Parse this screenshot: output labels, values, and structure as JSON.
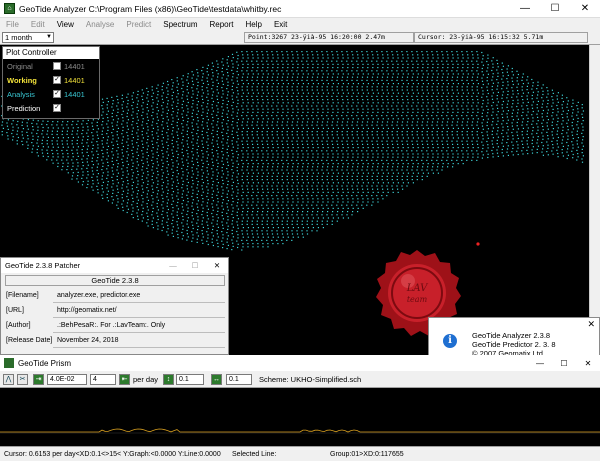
{
  "window": {
    "title": "GeoTide Analyzer  C:\\Program Files (x86)\\GeoTide\\testdata\\whitby.rec",
    "min": "—",
    "max": "☐",
    "close": "✕"
  },
  "menu": [
    "File",
    "Edit",
    "View",
    "Analyse",
    "Predict",
    "Spectrum",
    "Report",
    "Help",
    "Exit"
  ],
  "menu_disabled": [
    true,
    true,
    false,
    true,
    true,
    false,
    false,
    false,
    false
  ],
  "toolbar": {
    "range": "1 month",
    "point": "Point:3267 23-ÿià-95 16:20:00 2.47m",
    "cursor": "Cursor:  23-ÿià-95 16:15:32 5.71m"
  },
  "plot_controller": {
    "title": "Plot Controller",
    "rows": [
      {
        "label": "Original",
        "value": "14401",
        "checked": false,
        "color": "#8c8c8c"
      },
      {
        "label": "Working",
        "value": "14401",
        "checked": true,
        "color": "#f2e23a"
      },
      {
        "label": "Analysis",
        "value": "14401",
        "checked": true,
        "color": "#39c6d2"
      },
      {
        "label": "Prediction",
        "value": "",
        "checked": true,
        "color": "#ffffff"
      }
    ]
  },
  "patcher": {
    "title": "GeoTide 2.3.8 Patcher",
    "version": "GeoTide 2.3.8",
    "rows": [
      {
        "key": "[Filename]",
        "value": "analyzer.exe, predictor.exe"
      },
      {
        "key": "[URL]",
        "value": "http://geomatix.net/"
      },
      {
        "key": "[Author]",
        "value": ".:BehPesaR:. For .:LavTeam:. Only"
      },
      {
        "key": "[Release Date]",
        "value": "November 24, 2018"
      }
    ]
  },
  "about": {
    "line1": "GeoTide Analyzer 2.3.8",
    "line2": "GeoTide Predictor  2. 3. 8",
    "line3": "© 2007 Geomatix Ltd",
    "ok": "OK",
    "close": "✕"
  },
  "prism": {
    "title": "GeoTide Prism",
    "from": "4.0E-02",
    "to_label": "to",
    "to": "4",
    "unit": "per day",
    "step1": "0.1",
    "step2": "0.1",
    "scheme": "Scheme: UKHO-Simplified.sch"
  },
  "status": {
    "cursor": "Cursor:   0.6153 per day<XD:0.1<>15< Y:Graph:<0.0000 Y:Line:0.0000",
    "selected": "Selected Line:",
    "group": "Group:01>XD:0:117655"
  },
  "seal": {
    "text": "LAV team",
    "color": "#b5141c"
  },
  "colors": {
    "tide": "#3fd3d8",
    "accent": "#1f6fd1"
  }
}
